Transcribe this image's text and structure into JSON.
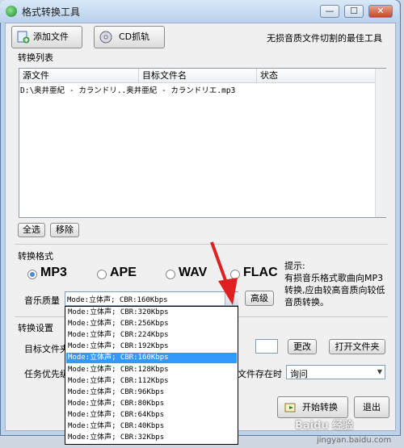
{
  "window": {
    "title": "格式转换工具",
    "min": "—",
    "max": "☐",
    "close": "✕"
  },
  "toolbar": {
    "add_file": "添加文件",
    "cd_rip": "CD抓轨",
    "slogan": "无损音质文件切割的最佳工具"
  },
  "list": {
    "label": "转换列表",
    "columns": [
      "源文件",
      "目标文件名",
      "状态"
    ],
    "rows": [
      {
        "source": "D:\\奥井亜紀 - カランドリ..",
        "target": "奥井亜紀 - カランドリエ.mp3",
        "status": ""
      }
    ]
  },
  "list_actions": {
    "select_all": "全选",
    "remove": "移除"
  },
  "format": {
    "label": "转换格式",
    "options": [
      "MP3",
      "APE",
      "WAV",
      "FLAC"
    ],
    "selected": "MP3",
    "hint_title": "提示:",
    "hint_body": "有损音乐格式歌曲向MP3转换,应由较高音质向较低音质转换。"
  },
  "quality": {
    "label": "音乐质量",
    "value": "Mode:立体声; CBR:160Kbps",
    "advanced": "高级",
    "options": [
      "Mode:立体声; CBR:320Kbps",
      "Mode:立体声; CBR:256Kbps",
      "Mode:立体声; CBR:224Kbps",
      "Mode:立体声; CBR:192Kbps",
      "Mode:立体声; CBR:160Kbps",
      "Mode:立体声; CBR:128Kbps",
      "Mode:立体声; CBR:112Kbps",
      "Mode:立体声; CBR:96Kbps",
      "Mode:立体声; CBR:80Kbps",
      "Mode:立体声; CBR:64Kbps",
      "Mode:立体声; CBR:40Kbps",
      "Mode:立体声; CBR:32Kbps"
    ],
    "selected_index": 4
  },
  "settings": {
    "label": "转换设置",
    "target_folder_label": "目标文件夹",
    "change": "更改",
    "open_folder": "打开文件夹",
    "priority_label": "任务优先级",
    "exists_label": "文件存在时",
    "exists_value": "询问"
  },
  "actions": {
    "start": "开始转换",
    "exit": "退出"
  },
  "watermark": {
    "line1": "Baidu 经验",
    "line2": "jingyan.baidu.com"
  },
  "colors": {
    "selection": "#3399ff",
    "arrow": "#e02020",
    "title_bar": "#c8dcf2"
  }
}
